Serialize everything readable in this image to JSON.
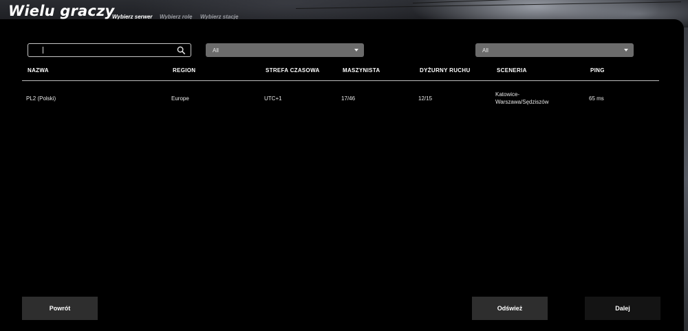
{
  "app": {
    "title": "Wielu graczy"
  },
  "tabs": [
    {
      "label": "Wybierz serwer",
      "active": true
    },
    {
      "label": "Wybierz rolę",
      "active": false
    },
    {
      "label": "Wybierz stację",
      "active": false
    }
  ],
  "filters": {
    "search_value": "",
    "region_select": "All",
    "scenery_select": "All"
  },
  "table": {
    "columns": [
      "NAZWA",
      "REGION",
      "STREFA CZASOWA",
      "MASZYNISTA",
      "DYŻURNY RUCHU",
      "SCENERIA",
      "PING"
    ],
    "rows": [
      {
        "name": "PL2 (Polski)",
        "region": "Europe",
        "timezone": "UTC+1",
        "driver": "17/46",
        "dispatcher": "12/15",
        "scenery_line1": "Katowice-",
        "scenery_line2": "Warszawa/Sędziszów",
        "ping": "65 ms"
      }
    ]
  },
  "buttons": {
    "back": "Powrót",
    "refresh": "Odśwież",
    "next": "Dalej"
  },
  "icons": {
    "search": "search-icon",
    "dropdown": "chevron-down-icon"
  },
  "colors": {
    "panel": "#000000",
    "select_bg": "#6b6b6b",
    "button_bg": "#2e2e2e",
    "button_dark_bg": "#141414"
  }
}
